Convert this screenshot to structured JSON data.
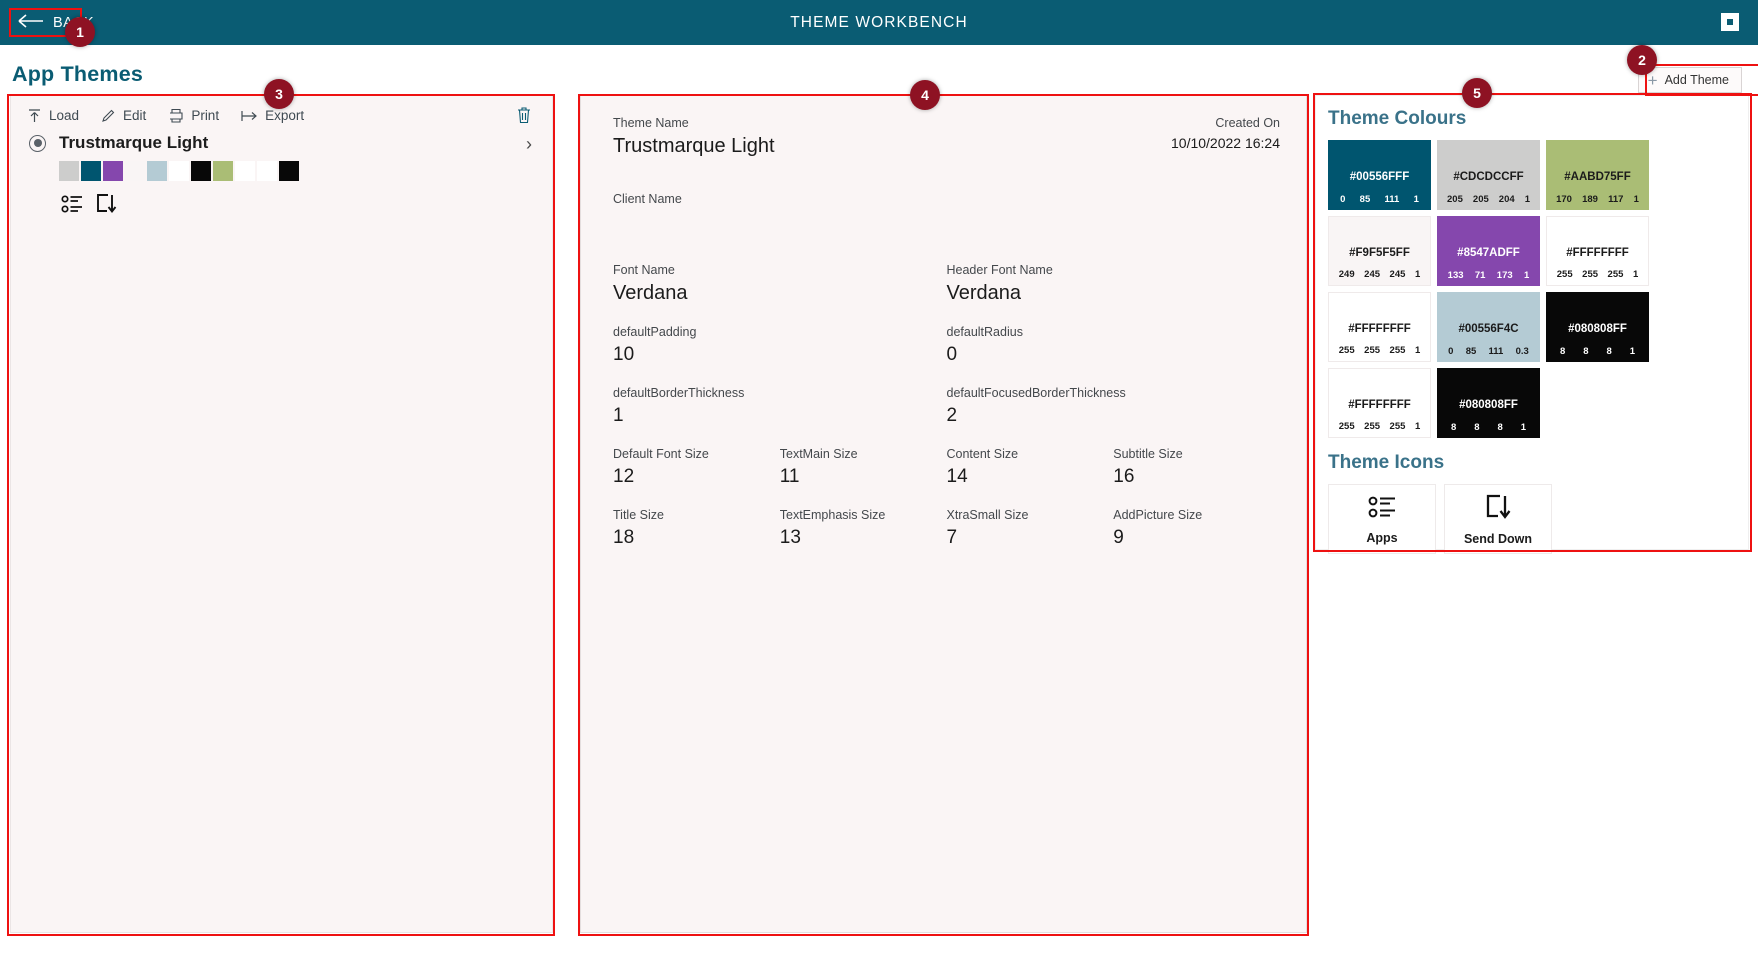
{
  "titlebar": {
    "back_label": "BACK",
    "title": "THEME WORKBENCH",
    "bg": "#0a5c73"
  },
  "page": {
    "heading": "App Themes",
    "add_theme_label": "Add Theme"
  },
  "left_panel": {
    "toolbar": [
      {
        "label": "Load",
        "icon": "upload-icon"
      },
      {
        "label": "Edit",
        "icon": "pencil-icon"
      },
      {
        "label": "Print",
        "icon": "printer-icon"
      },
      {
        "label": "Export",
        "icon": "export-arrow-icon"
      }
    ],
    "delete_icon": "trash-icon",
    "theme": {
      "name": "Trustmarque Light",
      "selected": true,
      "chevron": "›",
      "swatches": [
        "#CDCDCC",
        "#00556F",
        "#8547AD",
        "#F9F5F5",
        "#B4CBD4",
        "#FFFFFF",
        "#080808",
        "#AABD75",
        "#FFFFFF",
        "#FFFFFF",
        "#080808"
      ],
      "icons": [
        "apps-icon",
        "send-down-icon"
      ]
    }
  },
  "details": {
    "theme_name_label": "Theme Name",
    "theme_name_value": "Trustmarque Light",
    "created_on_label": "Created On",
    "created_on_value": "10/10/2022 16:24",
    "client_name_label": "Client Name",
    "client_name_value": "",
    "fonts": [
      {
        "label": "Font Name",
        "value": "Verdana"
      },
      {
        "label": "Header Font Name",
        "value": "Verdana"
      }
    ],
    "metrics_row1": [
      {
        "label": "defaultPadding",
        "value": "10"
      },
      {
        "label": "defaultRadius",
        "value": "0"
      }
    ],
    "metrics_row2": [
      {
        "label": "defaultBorderThickness",
        "value": "1"
      },
      {
        "label": "defaultFocusedBorderThickness",
        "value": "2"
      }
    ],
    "sizes_row1": [
      {
        "label": "Default Font Size",
        "value": "12"
      },
      {
        "label": "TextMain Size",
        "value": "11"
      },
      {
        "label": "Content Size",
        "value": "14"
      },
      {
        "label": "Subtitle Size",
        "value": "16"
      }
    ],
    "sizes_row2": [
      {
        "label": "Title Size",
        "value": "18"
      },
      {
        "label": "TextEmphasis Size",
        "value": "13"
      },
      {
        "label": "XtraSmall Size",
        "value": "7"
      },
      {
        "label": "AddPicture Size",
        "value": "9"
      }
    ]
  },
  "theme_colours": {
    "title": "Theme Colours",
    "tiles": [
      {
        "hex": "#00556FFF",
        "css": "#00556F",
        "text": "#ffffff",
        "r": "0",
        "g": "85",
        "b": "111",
        "a": "1"
      },
      {
        "hex": "#CDCDCCFF",
        "css": "#CDCDCC",
        "text": "#1b1b1b",
        "r": "205",
        "g": "205",
        "b": "204",
        "a": "1"
      },
      {
        "hex": "#AABD75FF",
        "css": "#AABD75",
        "text": "#1b1b1b",
        "r": "170",
        "g": "189",
        "b": "117",
        "a": "1"
      },
      {
        "hex": "#F9F5F5FF",
        "css": "#F9F5F5",
        "text": "#1b1b1b",
        "r": "249",
        "g": "245",
        "b": "245",
        "a": "1"
      },
      {
        "hex": "#8547ADFF",
        "css": "#8547AD",
        "text": "#ffffff",
        "r": "133",
        "g": "71",
        "b": "173",
        "a": "1"
      },
      {
        "hex": "#FFFFFFFF",
        "css": "#FFFFFF",
        "text": "#1b1b1b",
        "r": "255",
        "g": "255",
        "b": "255",
        "a": "1"
      },
      {
        "hex": "#FFFFFFFF",
        "css": "#FFFFFF",
        "text": "#1b1b1b",
        "r": "255",
        "g": "255",
        "b": "255",
        "a": "1"
      },
      {
        "hex": "#00556F4C",
        "css": "#B4CBD4",
        "text": "#1b1b1b",
        "r": "0",
        "g": "85",
        "b": "111",
        "a": "0.3"
      },
      {
        "hex": "#080808FF",
        "css": "#080808",
        "text": "#ffffff",
        "r": "8",
        "g": "8",
        "b": "8",
        "a": "1"
      },
      {
        "hex": "#FFFFFFFF",
        "css": "#FFFFFF",
        "text": "#1b1b1b",
        "r": "255",
        "g": "255",
        "b": "255",
        "a": "1"
      },
      {
        "hex": "#080808FF",
        "css": "#080808",
        "text": "#ffffff",
        "r": "8",
        "g": "8",
        "b": "8",
        "a": "1"
      }
    ]
  },
  "theme_icons": {
    "title": "Theme Icons",
    "items": [
      {
        "label": "Apps",
        "icon": "apps-icon"
      },
      {
        "label": "Send Down",
        "icon": "send-down-icon"
      }
    ]
  },
  "annotations": [
    {
      "number": "1"
    },
    {
      "number": "2"
    },
    {
      "number": "3"
    },
    {
      "number": "4"
    },
    {
      "number": "5"
    }
  ]
}
